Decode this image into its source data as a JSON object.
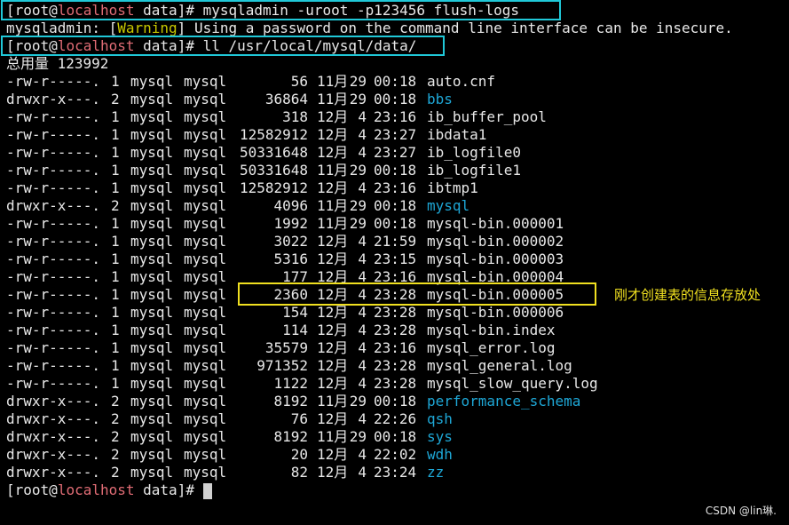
{
  "terminal": {
    "cmd1": {
      "prompt_user": "root",
      "prompt_host": "localhost",
      "prompt_dir": "data",
      "command": "mysqladmin -uroot -p123456 flush-logs"
    },
    "warning": {
      "prefix": "mysqladmin: [",
      "tag": "Warning",
      "message": "] Using a password on the command line interface can be insecure."
    },
    "cmd2": {
      "prompt_user": "root",
      "prompt_host": "localhost",
      "prompt_dir": "data",
      "command": "ll /usr/local/mysql/data/"
    },
    "total": "总用量 123992",
    "files": [
      {
        "perm": "-rw-r-----.",
        "links": "1",
        "owner": "mysql",
        "group": "mysql",
        "size": "56",
        "month": "11月",
        "day": "29",
        "time": "00:18",
        "name": "auto.cnf",
        "is_dir": false
      },
      {
        "perm": "drwxr-x---.",
        "links": "2",
        "owner": "mysql",
        "group": "mysql",
        "size": "36864",
        "month": "11月",
        "day": "29",
        "time": "00:18",
        "name": "bbs",
        "is_dir": true
      },
      {
        "perm": "-rw-r-----.",
        "links": "1",
        "owner": "mysql",
        "group": "mysql",
        "size": "318",
        "month": "12月",
        "day": "4",
        "time": "23:16",
        "name": "ib_buffer_pool",
        "is_dir": false
      },
      {
        "perm": "-rw-r-----.",
        "links": "1",
        "owner": "mysql",
        "group": "mysql",
        "size": "12582912",
        "month": "12月",
        "day": "4",
        "time": "23:27",
        "name": "ibdata1",
        "is_dir": false
      },
      {
        "perm": "-rw-r-----.",
        "links": "1",
        "owner": "mysql",
        "group": "mysql",
        "size": "50331648",
        "month": "12月",
        "day": "4",
        "time": "23:27",
        "name": "ib_logfile0",
        "is_dir": false
      },
      {
        "perm": "-rw-r-----.",
        "links": "1",
        "owner": "mysql",
        "group": "mysql",
        "size": "50331648",
        "month": "11月",
        "day": "29",
        "time": "00:18",
        "name": "ib_logfile1",
        "is_dir": false
      },
      {
        "perm": "-rw-r-----.",
        "links": "1",
        "owner": "mysql",
        "group": "mysql",
        "size": "12582912",
        "month": "12月",
        "day": "4",
        "time": "23:16",
        "name": "ibtmp1",
        "is_dir": false
      },
      {
        "perm": "drwxr-x---.",
        "links": "2",
        "owner": "mysql",
        "group": "mysql",
        "size": "4096",
        "month": "11月",
        "day": "29",
        "time": "00:18",
        "name": "mysql",
        "is_dir": true
      },
      {
        "perm": "-rw-r-----.",
        "links": "1",
        "owner": "mysql",
        "group": "mysql",
        "size": "1992",
        "month": "11月",
        "day": "29",
        "time": "00:18",
        "name": "mysql-bin.000001",
        "is_dir": false
      },
      {
        "perm": "-rw-r-----.",
        "links": "1",
        "owner": "mysql",
        "group": "mysql",
        "size": "3022",
        "month": "12月",
        "day": "4",
        "time": "21:59",
        "name": "mysql-bin.000002",
        "is_dir": false
      },
      {
        "perm": "-rw-r-----.",
        "links": "1",
        "owner": "mysql",
        "group": "mysql",
        "size": "5316",
        "month": "12月",
        "day": "4",
        "time": "23:15",
        "name": "mysql-bin.000003",
        "is_dir": false
      },
      {
        "perm": "-rw-r-----.",
        "links": "1",
        "owner": "mysql",
        "group": "mysql",
        "size": "177",
        "month": "12月",
        "day": "4",
        "time": "23:16",
        "name": "mysql-bin.000004",
        "is_dir": false
      },
      {
        "perm": "-rw-r-----.",
        "links": "1",
        "owner": "mysql",
        "group": "mysql",
        "size": "2360",
        "month": "12月",
        "day": "4",
        "time": "23:28",
        "name": "mysql-bin.000005",
        "is_dir": false
      },
      {
        "perm": "-rw-r-----.",
        "links": "1",
        "owner": "mysql",
        "group": "mysql",
        "size": "154",
        "month": "12月",
        "day": "4",
        "time": "23:28",
        "name": "mysql-bin.000006",
        "is_dir": false
      },
      {
        "perm": "-rw-r-----.",
        "links": "1",
        "owner": "mysql",
        "group": "mysql",
        "size": "114",
        "month": "12月",
        "day": "4",
        "time": "23:28",
        "name": "mysql-bin.index",
        "is_dir": false
      },
      {
        "perm": "-rw-r-----.",
        "links": "1",
        "owner": "mysql",
        "group": "mysql",
        "size": "35579",
        "month": "12月",
        "day": "4",
        "time": "23:16",
        "name": "mysql_error.log",
        "is_dir": false
      },
      {
        "perm": "-rw-r-----.",
        "links": "1",
        "owner": "mysql",
        "group": "mysql",
        "size": "971352",
        "month": "12月",
        "day": "4",
        "time": "23:28",
        "name": "mysql_general.log",
        "is_dir": false
      },
      {
        "perm": "-rw-r-----.",
        "links": "1",
        "owner": "mysql",
        "group": "mysql",
        "size": "1122",
        "month": "12月",
        "day": "4",
        "time": "23:28",
        "name": "mysql_slow_query.log",
        "is_dir": false
      },
      {
        "perm": "drwxr-x---.",
        "links": "2",
        "owner": "mysql",
        "group": "mysql",
        "size": "8192",
        "month": "11月",
        "day": "29",
        "time": "00:18",
        "name": "performance_schema",
        "is_dir": true
      },
      {
        "perm": "drwxr-x---.",
        "links": "2",
        "owner": "mysql",
        "group": "mysql",
        "size": "76",
        "month": "12月",
        "day": "4",
        "time": "22:26",
        "name": "qsh",
        "is_dir": true
      },
      {
        "perm": "drwxr-x---.",
        "links": "2",
        "owner": "mysql",
        "group": "mysql",
        "size": "8192",
        "month": "11月",
        "day": "29",
        "time": "00:18",
        "name": "sys",
        "is_dir": true
      },
      {
        "perm": "drwxr-x---.",
        "links": "2",
        "owner": "mysql",
        "group": "mysql",
        "size": "20",
        "month": "12月",
        "day": "4",
        "time": "22:02",
        "name": "wdh",
        "is_dir": true
      },
      {
        "perm": "drwxr-x---.",
        "links": "2",
        "owner": "mysql",
        "group": "mysql",
        "size": "82",
        "month": "12月",
        "day": "4",
        "time": "23:24",
        "name": "zz",
        "is_dir": true
      }
    ],
    "final_prompt": {
      "prompt_user": "root",
      "prompt_host": "localhost",
      "prompt_dir": "data"
    }
  },
  "annotation": {
    "text": "刚才创建表的信息存放处"
  },
  "watermark": "CSDN @lin琳.",
  "colors": {
    "background": "#000000",
    "host": "#e06c75",
    "warning": "#c8c800",
    "directory": "#1ea7d6",
    "highlight_cyan": "#20c8d8",
    "highlight_yellow": "#f0e020"
  }
}
